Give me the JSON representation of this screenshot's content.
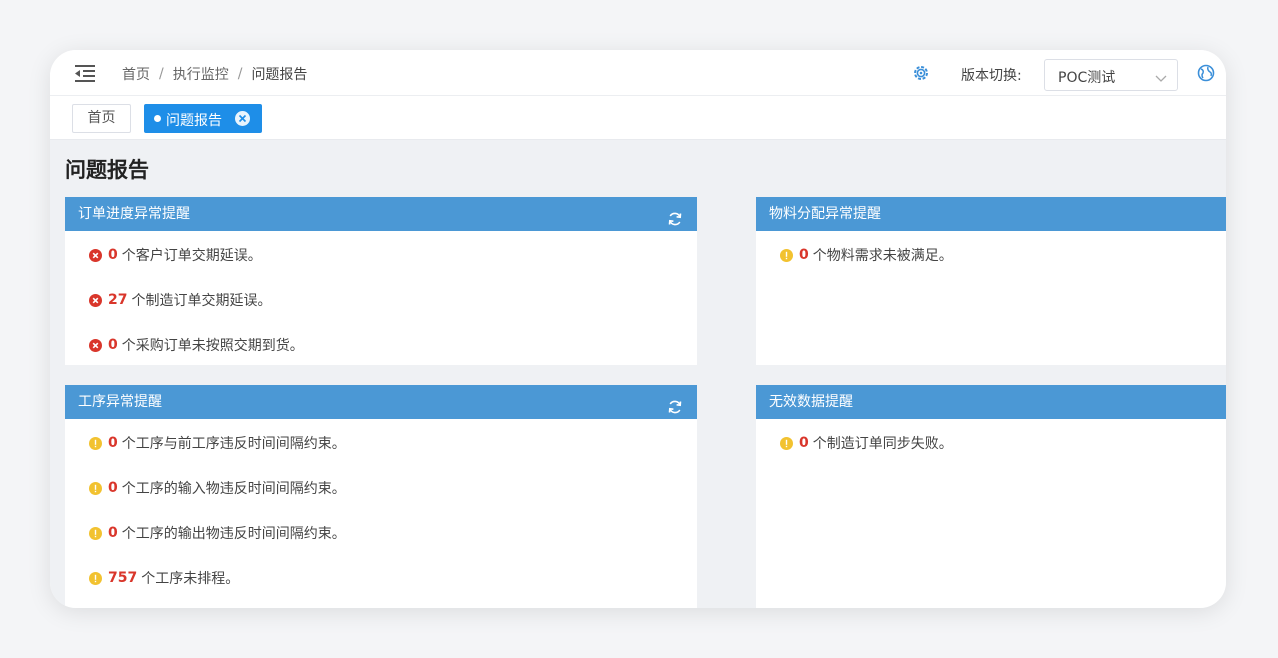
{
  "breadcrumb": [
    "首页",
    "执行监控",
    "问题报告"
  ],
  "breadcrumb_sep": "/",
  "header": {
    "version_label": "版本切换:",
    "version_value": "POC测试"
  },
  "tabs": {
    "home": "首页",
    "active": "问题报告"
  },
  "page_title": "问题报告",
  "colors": {
    "panel_header": "#4b98d5",
    "active_tab": "#1e8ee8",
    "error": "#d9362b",
    "warning": "#f2c230"
  },
  "panels": {
    "order": {
      "title": "订单进度异常提醒",
      "items": [
        {
          "icon": "error-icon",
          "count": "0",
          "text": "个客户订单交期延误。"
        },
        {
          "icon": "error-icon",
          "count": "27",
          "text": "个制造订单交期延误。"
        },
        {
          "icon": "error-icon",
          "count": "0",
          "text": "个采购订单未按照交期到货。"
        }
      ]
    },
    "material": {
      "title": "物料分配异常提醒",
      "items": [
        {
          "icon": "warning-icon",
          "count": "0",
          "text": "个物料需求未被满足。"
        }
      ]
    },
    "process": {
      "title": "工序异常提醒",
      "items": [
        {
          "icon": "warning-icon",
          "count": "0",
          "text": "个工序与前工序违反时间间隔约束。"
        },
        {
          "icon": "warning-icon",
          "count": "0",
          "text": "个工序的输入物违反时间间隔约束。"
        },
        {
          "icon": "warning-icon",
          "count": "0",
          "text": "个工序的输出物违反时间间隔约束。"
        },
        {
          "icon": "warning-icon",
          "count": "757",
          "text": "个工序未排程。"
        }
      ]
    },
    "invalid": {
      "title": "无效数据提醒",
      "items": [
        {
          "icon": "warning-icon",
          "count": "0",
          "text": "个制造订单同步失败。"
        }
      ]
    }
  }
}
